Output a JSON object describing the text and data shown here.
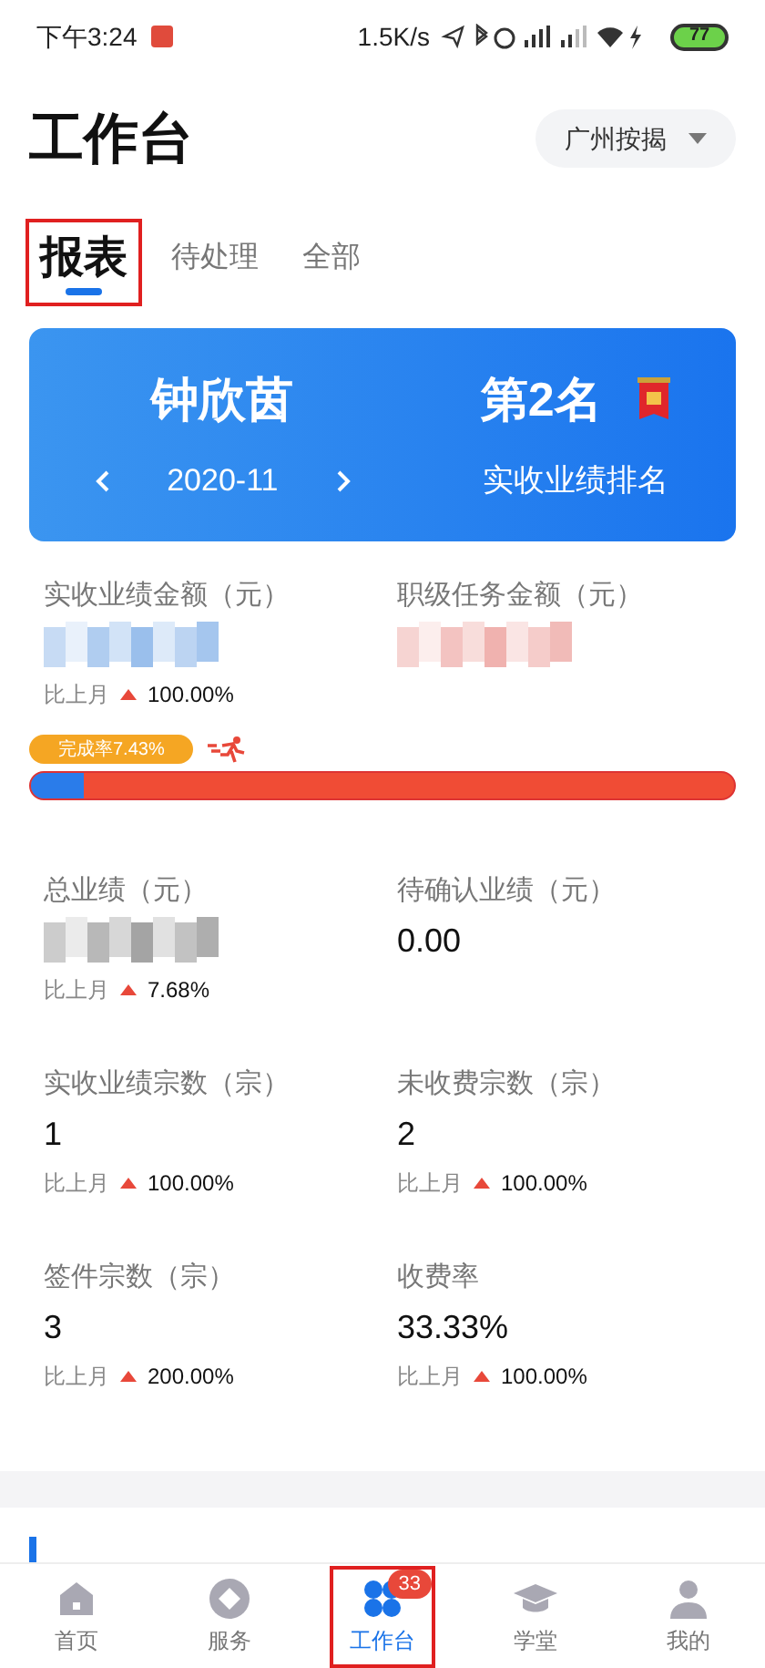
{
  "status_bar": {
    "time": "下午3:24",
    "speed": "1.5K/s",
    "battery": "77"
  },
  "header": {
    "title": "工作台",
    "store": "广州按揭"
  },
  "tabs": [
    {
      "label": "报表",
      "selected": true,
      "highlighted": true
    },
    {
      "label": "待处理",
      "selected": false,
      "highlighted": false
    },
    {
      "label": "全部",
      "selected": false,
      "highlighted": false
    }
  ],
  "rank_card": {
    "name": "钟欣茵",
    "month": "2020-11",
    "rank": "第2名",
    "rank_label": "实收业绩排名"
  },
  "top_metrics": [
    {
      "label": "实收业绩金额（元）",
      "kind": "blurred",
      "color": "#8fb8ea",
      "compare_label": "比上月",
      "change": "100.00%"
    },
    {
      "label": "职级任务金额（元）",
      "kind": "blurred",
      "color": "#eeaaa6"
    }
  ],
  "progress": {
    "label": "完成率7.43%",
    "level": 0.0743
  },
  "metrics": [
    {
      "label": "总业绩（元）",
      "kind": "blurred",
      "color": "#9a9a9a",
      "compare_label": "比上月",
      "change": "7.68%"
    },
    {
      "label": "待确认业绩（元）",
      "kind": "value",
      "value": "0.00"
    },
    {
      "label": "实收业绩宗数（宗）",
      "kind": "value",
      "value": "1",
      "compare_label": "比上月",
      "change": "100.00%"
    },
    {
      "label": "未收费宗数（宗）",
      "kind": "value",
      "value": "2",
      "compare_label": "比上月",
      "change": "100.00%"
    },
    {
      "label": "签件宗数（宗）",
      "kind": "value",
      "value": "3",
      "compare_label": "比上月",
      "change": "200.00%"
    },
    {
      "label": "收费率",
      "kind": "value",
      "value": "33.33%",
      "compare_label": "比上月",
      "change": "100.00%"
    }
  ],
  "bottom_nav": [
    {
      "label": "首页",
      "kind": "home",
      "selected": false,
      "highlighted": false
    },
    {
      "label": "服务",
      "kind": "service",
      "selected": false,
      "highlighted": false
    },
    {
      "label": "工作台",
      "kind": "workbench",
      "selected": true,
      "highlighted": true,
      "badge": "33"
    },
    {
      "label": "学堂",
      "kind": "school",
      "selected": false,
      "highlighted": false
    },
    {
      "label": "我的",
      "kind": "me",
      "selected": false,
      "highlighted": false
    }
  ]
}
